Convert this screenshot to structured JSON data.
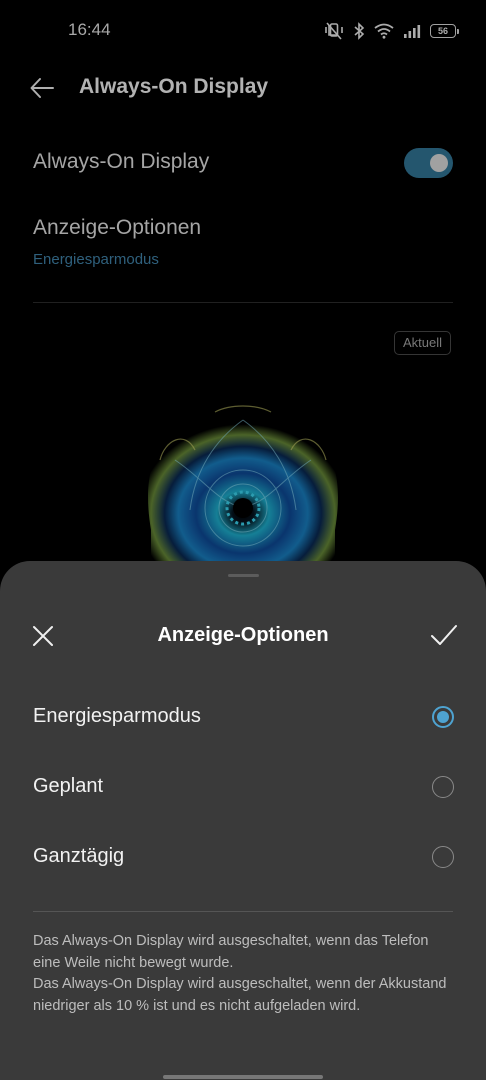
{
  "status_bar": {
    "time": "16:44",
    "battery": "56",
    "icons": [
      "mute-vibrate-icon",
      "bluetooth-icon",
      "wifi-icon",
      "cellular-signal-icon",
      "battery-icon"
    ]
  },
  "page": {
    "title": "Always-On Display",
    "aod_toggle": {
      "label": "Always-On Display",
      "on": true
    },
    "display_options": {
      "label": "Anzeige-Optionen",
      "value": "Energiesparmodus"
    },
    "current_badge": "Aktuell"
  },
  "sheet": {
    "title": "Anzeige-Optionen",
    "options": [
      {
        "label": "Energiesparmodus",
        "selected": true
      },
      {
        "label": "Geplant",
        "selected": false
      },
      {
        "label": "Ganztägig",
        "selected": false
      }
    ],
    "description": [
      "Das Always-On Display wird ausgeschaltet, wenn das Telefon eine Weile nicht bewegt wurde.",
      "Das Always-On Display wird ausgeschaltet, wenn der Akkustand niedriger als 10 % ist und es nicht aufgeladen wird."
    ]
  },
  "colors": {
    "accent": "#4ea3d1",
    "toggle_on": "#2f6f8e",
    "sheet_bg": "#3a3a3a"
  }
}
